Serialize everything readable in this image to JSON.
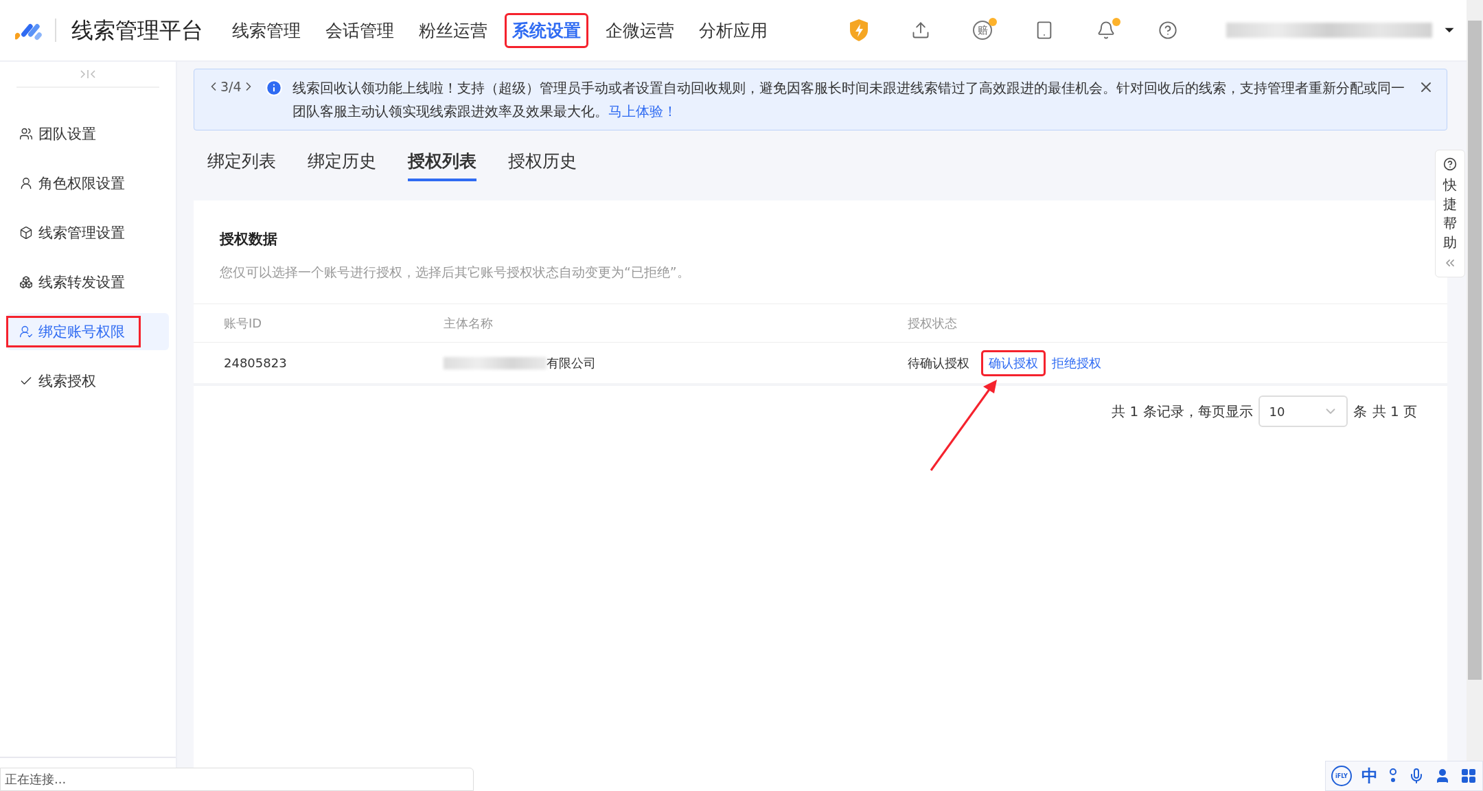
{
  "header": {
    "logo_title": "线索管理平台",
    "nav": [
      {
        "label": "线索管理",
        "selected": false,
        "annotated": false
      },
      {
        "label": "会话管理",
        "selected": false,
        "annotated": false
      },
      {
        "label": "粉丝运营",
        "selected": false,
        "annotated": false
      },
      {
        "label": "系统设置",
        "selected": true,
        "annotated": true
      },
      {
        "label": "企微运营",
        "selected": false,
        "annotated": false
      },
      {
        "label": "分析应用",
        "selected": false,
        "annotated": false
      }
    ],
    "icons": [
      {
        "kind": "shield",
        "badge": false
      },
      {
        "kind": "upload",
        "badge": false
      },
      {
        "kind": "claim",
        "label": "赔",
        "badge": true
      },
      {
        "kind": "tablet",
        "badge": false
      },
      {
        "kind": "bell",
        "badge": true
      },
      {
        "kind": "help",
        "badge": false
      }
    ]
  },
  "sidebar": {
    "items": [
      {
        "label": "团队设置",
        "kind": "team",
        "selected": false,
        "annotated": false
      },
      {
        "label": "角色权限设置",
        "kind": "role",
        "selected": false,
        "annotated": false
      },
      {
        "label": "线索管理设置",
        "kind": "cube",
        "selected": false,
        "annotated": false
      },
      {
        "label": "线索转发设置",
        "kind": "boxes",
        "selected": false,
        "annotated": false
      },
      {
        "label": "绑定账号权限",
        "kind": "bind",
        "selected": true,
        "annotated": true
      },
      {
        "label": "线索授权",
        "kind": "check",
        "selected": false,
        "annotated": false
      }
    ]
  },
  "banner": {
    "pager": "3/4",
    "message": "线索回收认领功能上线啦！支持（超级）管理员手动或者设置自动回收规则，避免因客服长时间未跟进线索错过了高效跟进的最佳机会。针对回收后的线索，支持管理者重新分配或同一团队客服主动认领实现线索跟进效率及效果最大化。",
    "link": "马上体验！"
  },
  "tabs": [
    {
      "label": "绑定列表",
      "selected": false
    },
    {
      "label": "绑定历史",
      "selected": false
    },
    {
      "label": "授权列表",
      "selected": true
    },
    {
      "label": "授权历史",
      "selected": false
    }
  ],
  "card": {
    "title": "授权数据",
    "description": "您仅可以选择一个账号进行授权，选择后其它账号授权状态自动变更为“已拒绝”。",
    "table": {
      "columns": [
        "账号ID",
        "主体名称",
        "授权状态"
      ],
      "rows": [
        {
          "account_id": "24805823",
          "entity_name": "有限公司",
          "status": "待确认授权",
          "actions": [
            {
              "label": "确认授权",
              "annotated": true
            },
            {
              "label": "拒绝授权",
              "annotated": false
            }
          ]
        }
      ]
    },
    "pagination": {
      "summary": "共 1 条记录，每页显示",
      "page_size": "10",
      "unit": "条",
      "pages": "共 1 页"
    }
  },
  "quick_help": {
    "label": "快捷帮助"
  },
  "status_popup": {
    "text": "正在连接..."
  },
  "ime_bar": {
    "logo": "iFLY",
    "mode": "中"
  }
}
